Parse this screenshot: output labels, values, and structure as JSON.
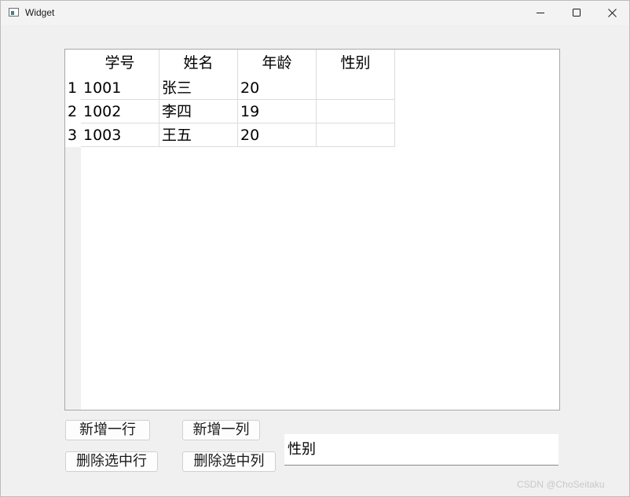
{
  "window": {
    "title": "Widget"
  },
  "table": {
    "columns": [
      "学号",
      "姓名",
      "年龄",
      "性别"
    ],
    "row_headers": [
      "1",
      "2",
      "3"
    ],
    "rows": [
      [
        "1001",
        "张三",
        "20",
        ""
      ],
      [
        "1002",
        "李四",
        "19",
        ""
      ],
      [
        "1003",
        "王五",
        "20",
        ""
      ]
    ]
  },
  "buttons": {
    "add_row": "新增一行",
    "add_column": "新增一列",
    "delete_row": "删除选中行",
    "delete_column": "删除选中列"
  },
  "column_name_input": {
    "value": "性别"
  },
  "watermark": "CSDN @ChoSeitaku",
  "colors": {
    "window_bg": "#f0f0f0",
    "table_bg": "#ffffff",
    "grid": "#dcdcdc"
  }
}
